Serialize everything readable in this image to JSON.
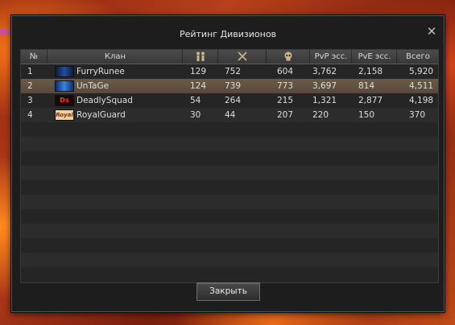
{
  "background_tag": "BA",
  "window": {
    "title": "Рейтинг Дивизионов",
    "close_label": "✕",
    "close_button": "Закрыть"
  },
  "table": {
    "columns": {
      "rank": "№",
      "clan": "Клан",
      "members_icon": "members-icon",
      "kills_icon": "crossed-swords-icon",
      "deaths_icon": "skull-icon",
      "pvp": "PvP эсс.",
      "pve": "PvE эсс.",
      "total": "Всего"
    },
    "rows": [
      {
        "rank": "1",
        "clan": "FurryRunee",
        "emblem": "",
        "members": "129",
        "kills": "752",
        "deaths": "604",
        "pvp": "3,762",
        "pve": "2,158",
        "total": "5,920"
      },
      {
        "rank": "2",
        "clan": "UnTaGe",
        "emblem": "",
        "members": "124",
        "kills": "739",
        "deaths": "773",
        "pvp": "3,697",
        "pve": "814",
        "total": "4,511"
      },
      {
        "rank": "3",
        "clan": "DeadlySquad",
        "emblem": "Ds",
        "members": "54",
        "kills": "264",
        "deaths": "215",
        "pvp": "1,321",
        "pve": "2,877",
        "total": "4,198"
      },
      {
        "rank": "4",
        "clan": "RoyalGuard",
        "emblem": "Royal",
        "members": "30",
        "kills": "44",
        "deaths": "207",
        "pvp": "220",
        "pve": "150",
        "total": "370"
      }
    ],
    "selected_row": 2
  }
}
